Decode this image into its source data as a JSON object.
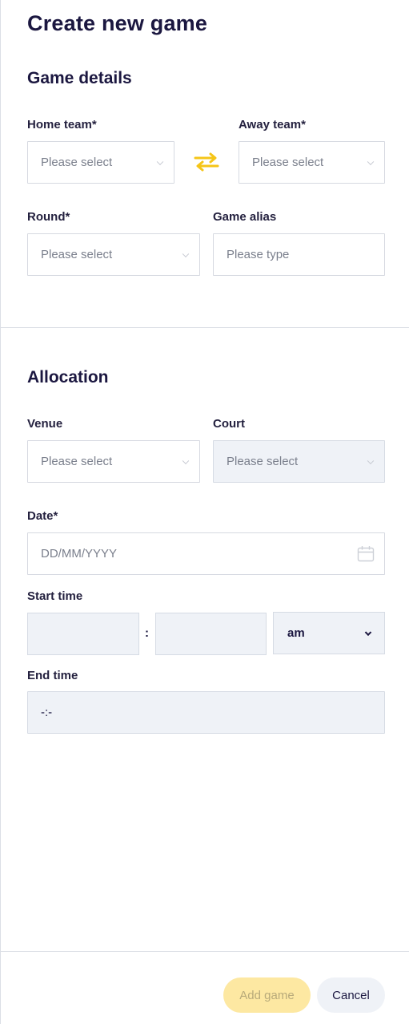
{
  "title": "Create new game",
  "game_details": {
    "heading": "Game details",
    "home_team": {
      "label": "Home team*",
      "placeholder": "Please select"
    },
    "away_team": {
      "label": "Away team*",
      "placeholder": "Please select"
    },
    "round": {
      "label": "Round*",
      "placeholder": "Please select"
    },
    "game_alias": {
      "label": "Game alias",
      "placeholder": "Please type"
    }
  },
  "allocation": {
    "heading": "Allocation",
    "venue": {
      "label": "Venue",
      "placeholder": "Please select"
    },
    "court": {
      "label": "Court",
      "placeholder": "Please select"
    },
    "date": {
      "label": "Date*",
      "placeholder": "DD/MM/YYYY"
    },
    "start_time": {
      "label": "Start time",
      "separator": ":",
      "period": "am"
    },
    "end_time": {
      "label": "End time",
      "value": "-:-"
    }
  },
  "actions": {
    "add_label": "Add game",
    "cancel_label": "Cancel"
  },
  "colors": {
    "accent": "#f5c518",
    "add_button_bg": "#fde8a2",
    "disabled_bg": "#eff2f7"
  }
}
